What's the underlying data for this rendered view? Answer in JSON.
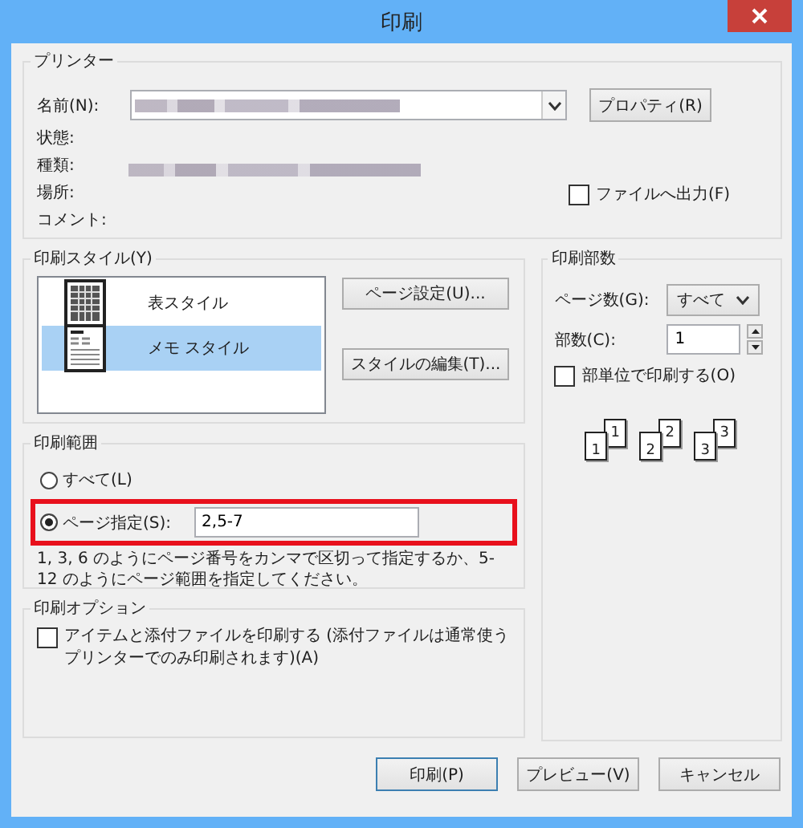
{
  "window": {
    "title": "印刷"
  },
  "printer": {
    "legend": "プリンター",
    "name_label": "名前(N):",
    "properties_button": "プロパティ(R)",
    "status_label": "状態:",
    "type_label": "種類:",
    "location_label": "場所:",
    "comment_label": "コメント:",
    "print_to_file": {
      "label": "ファイルへ出力(F)",
      "checked": false
    }
  },
  "print_style": {
    "legend": "印刷スタイル(Y)",
    "styles": [
      {
        "label": "表スタイル",
        "kind": "table",
        "selected": false
      },
      {
        "label": "メモ スタイル",
        "kind": "memo",
        "selected": true
      }
    ],
    "buttons": [
      "ページ設定(U)...",
      "スタイルの編集(T)..."
    ]
  },
  "copies": {
    "legend": "印刷部数",
    "pages_label": "ページ数(G):",
    "pages_value": "すべて",
    "count_label": "部数(C):",
    "count_value": "1",
    "collate": {
      "label": "部単位で印刷する(O)",
      "checked": false
    },
    "collate_pages": [
      {
        "front": "1",
        "back": "1"
      },
      {
        "front": "2",
        "back": "2"
      },
      {
        "front": "3",
        "back": "3"
      }
    ]
  },
  "range": {
    "legend": "印刷範囲",
    "options": [
      {
        "label": "すべて(L)",
        "selected": false,
        "highlighted": false
      },
      {
        "label": "ページ指定(S):",
        "selected": true,
        "value": "2,5-7",
        "highlighted": true
      }
    ],
    "hint": "1, 3, 6 のようにページ番号をカンマで区切って指定するか、5-12 のようにページ範囲を指定してください。"
  },
  "options": {
    "legend": "印刷オプション",
    "items": [
      {
        "label": "アイテムと添付ファイルを印刷する (添付ファイルは通常使うプリンターでのみ印刷されます)(A)",
        "checked": false
      }
    ]
  },
  "buttons": [
    {
      "label": "印刷(P)",
      "default": true
    },
    {
      "label": "プレビュー(V)",
      "default": false
    },
    {
      "label": "キャンセル",
      "default": false
    }
  ]
}
